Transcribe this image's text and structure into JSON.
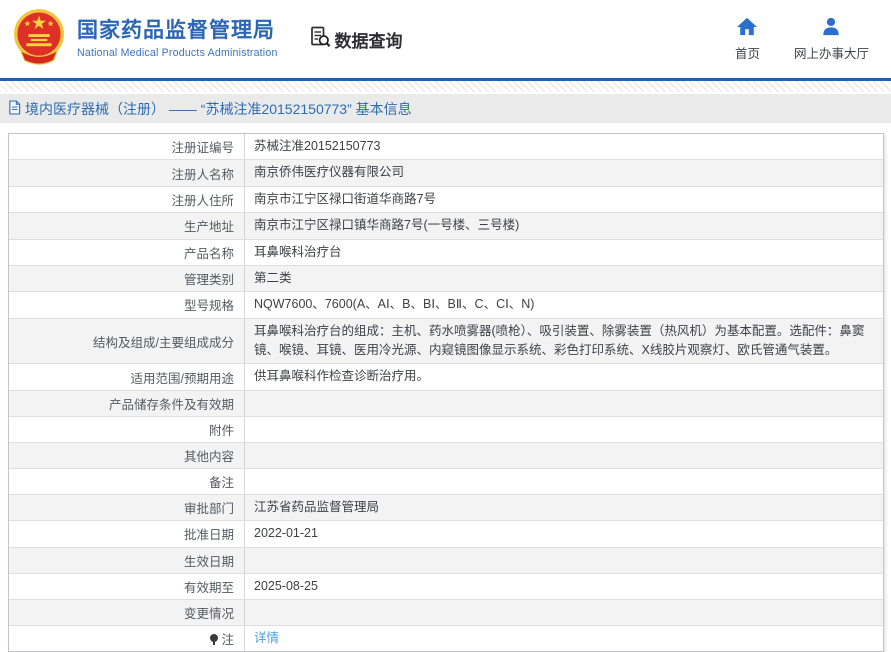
{
  "header": {
    "title": "国家药品监督管理局",
    "subtitle": "National Medical Products Administration",
    "data_query_label": "数据查询",
    "nav": [
      {
        "label": "首页",
        "icon": "home-icon"
      },
      {
        "label": "网上办事大厅",
        "icon": "user-icon"
      }
    ]
  },
  "colors": {
    "brand_blue": "#2a66b3",
    "icon_blue": "#2a6fd0",
    "divider_blue": "#1c63b8",
    "breadcrumb_blue": "#2e6cb0",
    "link_blue": "#4da0dd",
    "emblem_red": "#df3027",
    "emblem_gold": "#f3c53c",
    "breadcrumb_bar_bg": "#eaeaea",
    "alt_row_bg": "#f3f3f3"
  },
  "breadcrumb": {
    "text": "境内医疗器械（注册） —— “苏械注准20152150773” 基本信息"
  },
  "table": {
    "rows": [
      {
        "label": "注册证编号",
        "value": "苏械注准20152150773"
      },
      {
        "label": "注册人名称",
        "value": "南京侨伟医疗仪器有限公司"
      },
      {
        "label": "注册人住所",
        "value": "南京市江宁区禄口街道华商路7号"
      },
      {
        "label": "生产地址",
        "value": "南京市江宁区禄口镇华商路7号(一号楼、三号楼)"
      },
      {
        "label": "产品名称",
        "value": "耳鼻喉科治疗台"
      },
      {
        "label": "管理类别",
        "value": "第二类"
      },
      {
        "label": "型号规格",
        "value": "NQW7600、7600(A、AⅠ、B、BⅠ、BⅡ、C、CⅠ、N)"
      },
      {
        "label": "结构及组成/主要组成成分",
        "value": "耳鼻喉科治疗台的组成：主机、药水喷雾器(喷枪）、吸引装置、除雾装置（热风机）为基本配置。选配件：鼻窦镜、喉镜、耳镜、医用冷光源、内窥镜图像显示系统、彩色打印系统、X线胶片观察灯、欧氏管通气装置。"
      },
      {
        "label": "适用范围/预期用途",
        "value": "供耳鼻喉科作检查诊断治疗用。"
      },
      {
        "label": "产品储存条件及有效期",
        "value": ""
      },
      {
        "label": "附件",
        "value": ""
      },
      {
        "label": "其他内容",
        "value": ""
      },
      {
        "label": "备注",
        "value": ""
      },
      {
        "label": "审批部门",
        "value": "江苏省药品监督管理局"
      },
      {
        "label": "批准日期",
        "value": "2022-01-21"
      },
      {
        "label": "生效日期",
        "value": ""
      },
      {
        "label": "有效期至",
        "value": "2025-08-25"
      },
      {
        "label": "变更情况",
        "value": ""
      },
      {
        "label": "注",
        "value": "详情",
        "link": true,
        "pin": true
      }
    ]
  }
}
